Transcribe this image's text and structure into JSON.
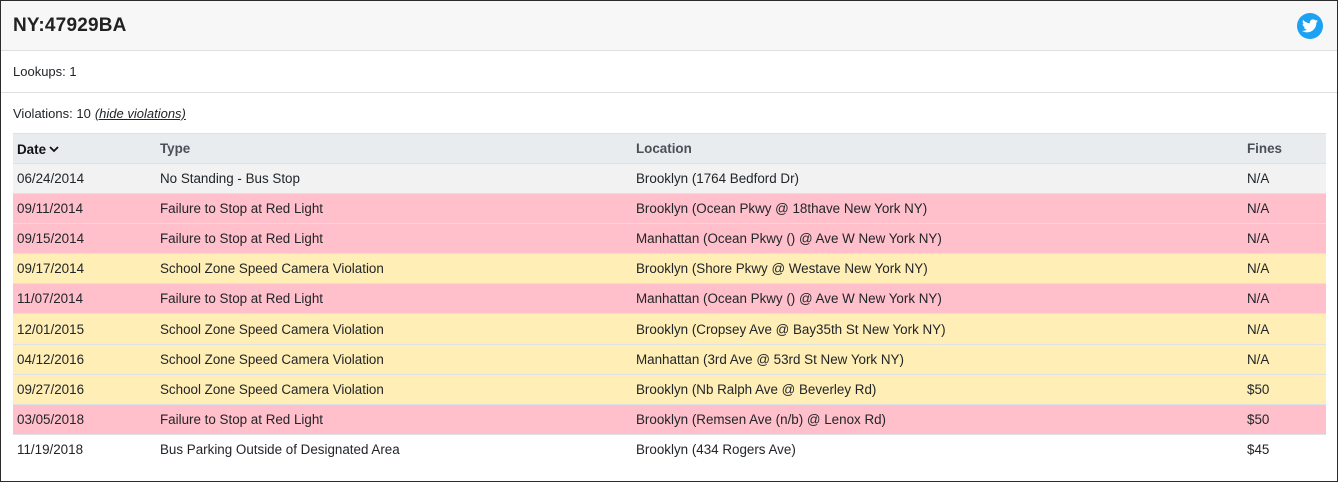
{
  "header": {
    "plate": "NY:47929BA",
    "share_icon": "twitter-icon",
    "share_color": "#1da1f2"
  },
  "lookups": {
    "label": "Lookups: 1"
  },
  "violations": {
    "summary": "Violations: 10",
    "toggle_label": "(hide violations)",
    "columns": {
      "date": "Date",
      "type": "Type",
      "location": "Location",
      "fines": "Fines"
    },
    "sort_icon": "chevron-down-icon",
    "row_colors": {
      "gray": "#f2f2f2",
      "red": "#ffc0cb",
      "yellow": "#ffeeb5",
      "white": "#ffffff"
    },
    "rows": [
      {
        "date": "06/24/2014",
        "type": "No Standing - Bus Stop",
        "location": "Brooklyn (1764 Bedford Dr)",
        "fines": "N/A",
        "shade": "gray"
      },
      {
        "date": "09/11/2014",
        "type": "Failure to Stop at Red Light",
        "location": "Brooklyn (Ocean Pkwy @ 18thave New York NY)",
        "fines": "N/A",
        "shade": "red"
      },
      {
        "date": "09/15/2014",
        "type": "Failure to Stop at Red Light",
        "location": "Manhattan (Ocean Pkwy () @ Ave W New York NY)",
        "fines": "N/A",
        "shade": "red"
      },
      {
        "date": "09/17/2014",
        "type": "School Zone Speed Camera Violation",
        "location": "Brooklyn (Shore Pkwy @ Westave New York NY)",
        "fines": "N/A",
        "shade": "yellow"
      },
      {
        "date": "11/07/2014",
        "type": "Failure to Stop at Red Light",
        "location": "Manhattan (Ocean Pkwy () @ Ave W New York NY)",
        "fines": "N/A",
        "shade": "red"
      },
      {
        "date": "12/01/2015",
        "type": "School Zone Speed Camera Violation",
        "location": "Brooklyn (Cropsey Ave @ Bay35th St New York NY)",
        "fines": "N/A",
        "shade": "yellow"
      },
      {
        "date": "04/12/2016",
        "type": "School Zone Speed Camera Violation",
        "location": "Manhattan (3rd Ave @ 53rd St New York NY)",
        "fines": "N/A",
        "shade": "yellow"
      },
      {
        "date": "09/27/2016",
        "type": "School Zone Speed Camera Violation",
        "location": "Brooklyn (Nb Ralph Ave @ Beverley Rd)",
        "fines": "$50",
        "shade": "yellow"
      },
      {
        "date": "03/05/2018",
        "type": "Failure to Stop at Red Light",
        "location": "Brooklyn (Remsen Ave (n/b) @ Lenox Rd)",
        "fines": "$50",
        "shade": "red"
      },
      {
        "date": "11/19/2018",
        "type": "Bus Parking Outside of Designated Area",
        "location": "Brooklyn (434 Rogers Ave)",
        "fines": "$45",
        "shade": "white"
      }
    ]
  }
}
